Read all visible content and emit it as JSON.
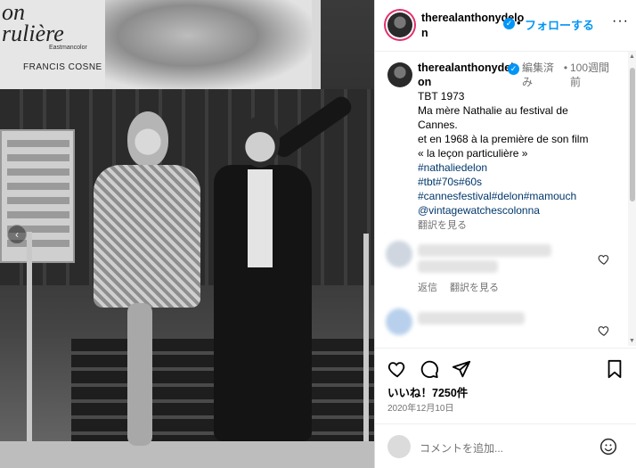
{
  "photo": {
    "poster_title": "on\nrulière",
    "poster_sub": "Eastmancolor",
    "poster_name": "FRANCIS COSNE"
  },
  "header": {
    "username": "therealanthonydelon",
    "follow_label": "フォローする",
    "dot": "•"
  },
  "caption": {
    "username": "therealanthonydelon",
    "edited": "編集済み",
    "dot": "•",
    "time": "100週間前",
    "lines": [
      "TBT 1973",
      "Ma mère Nathalie au festival de",
      "Cannes.",
      "et en 1968 à la première de son film",
      "« la leçon particulière »"
    ],
    "tags": [
      "#nathaliedelon",
      "#tbt#70s#60s",
      "#cannesfestival#delon#mamouch",
      "@vintagewatchescolonna"
    ],
    "translate": "翻訳を見る"
  },
  "comment1": {
    "reply": "返信",
    "translate": "翻訳を見る"
  },
  "post": {
    "likes": "いいね！7250件",
    "date": "2020年12月10日",
    "comment_placeholder": "コメントを追加..."
  },
  "icons": {
    "like": "heart-icon",
    "comment": "comment-icon",
    "share": "share-icon",
    "save": "bookmark-icon",
    "emoji": "emoji-icon",
    "verified": "verified-badge-icon"
  },
  "colors": {
    "accent": "#0095f6",
    "tag": "#00376b",
    "muted": "#737373"
  }
}
